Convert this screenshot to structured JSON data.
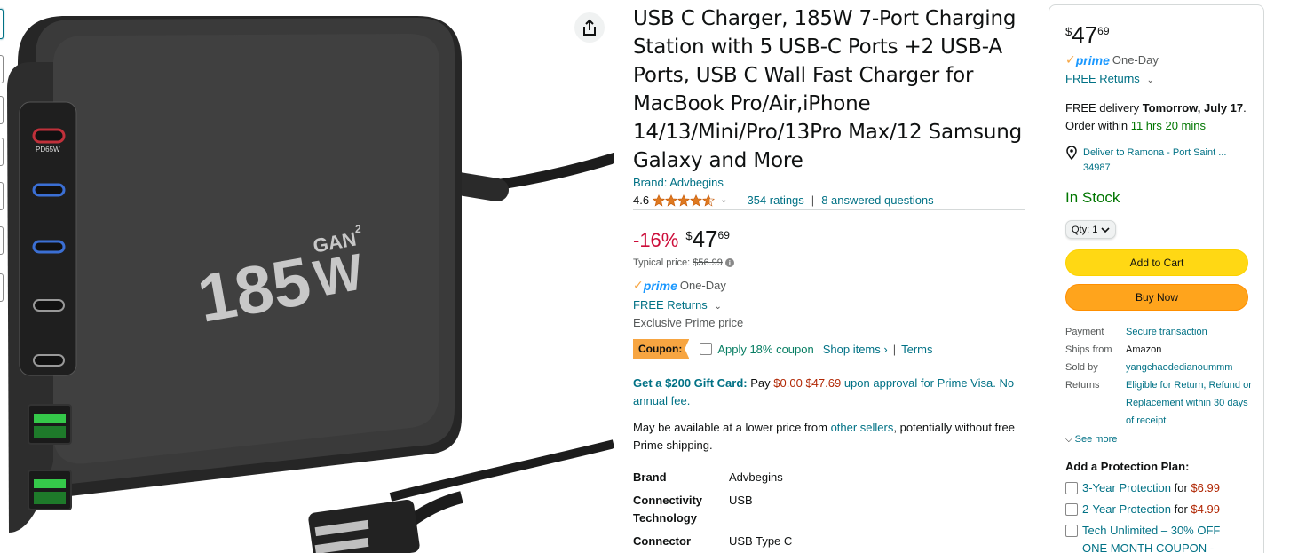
{
  "product": {
    "title": "USB C Charger, 185W 7-Port Charging Station with 5 USB-C Ports +2 USB-A Ports, USB C Wall Fast Charger for MacBook Pro/Air,iPhone 14/13/Mini/Pro/13Pro Max/12 Samsung Galaxy and More",
    "brand_link": "Brand: Advbegins",
    "rating": "4.6",
    "rating_value": 4.6,
    "ratings_count": "354 ratings",
    "answered_questions": "8 answered questions",
    "separator": "|"
  },
  "image": {
    "label_watts": "185",
    "label_w": "W",
    "label_gan": "GAN",
    "label_sup": "2",
    "port_label": "PD65W"
  },
  "pricing": {
    "discount": "-16%",
    "currency": "$",
    "price_whole": "47",
    "price_fraction": "69",
    "typical_label": "Typical price:",
    "typical_price": "$56.99",
    "info_icon": "i"
  },
  "prime": {
    "check": "✓",
    "logo": "prime",
    "speed": "One-Day",
    "free_returns": "FREE Returns",
    "exclusive": "Exclusive Prime price"
  },
  "coupon": {
    "badge": "Coupon:",
    "apply": "Apply 18% coupon",
    "shop_items": "Shop items ›",
    "separator": "|",
    "terms": "Terms"
  },
  "giftcard": {
    "bold": "Get a $200 Gift Card:",
    "pay": "Pay",
    "pay_amount": "$0.00",
    "old_amount": "$47.69",
    "rest": "upon approval for Prime Visa. No annual fee."
  },
  "lower_price": {
    "pre": "May be available at a lower price from",
    "link": "other sellers",
    "post": ", potentially without free Prime shipping."
  },
  "specs": [
    {
      "key": "Brand",
      "value": "Advbegins"
    },
    {
      "key": "Connectivity Technology",
      "value": "USB"
    },
    {
      "key": "Connector",
      "value": "USB Type C"
    }
  ],
  "buybox": {
    "currency": "$",
    "price_whole": "47",
    "price_fraction": "69",
    "check": "✓",
    "prime_logo": "prime",
    "prime_speed": "One-Day",
    "free_returns": "FREE Returns",
    "delivery_pre": "FREE delivery",
    "delivery_bold": "Tomorrow, July 17",
    "delivery_mid": ". Order within",
    "delivery_time": "11 hrs 20 mins",
    "deliver_to_line1": "Deliver to Ramona - Port Saint ...",
    "deliver_to_line2": "34987",
    "in_stock": "In Stock",
    "qty_label": "Qty: 1",
    "add_to_cart": "Add to Cart",
    "buy_now": "Buy Now",
    "details": [
      {
        "key": "Payment",
        "value": "Secure transaction",
        "link": true
      },
      {
        "key": "Ships from",
        "value": "Amazon",
        "link": false
      },
      {
        "key": "Sold by",
        "value": "yangchaodedianoummm",
        "link": true
      },
      {
        "key": "Returns",
        "value": "Eligible for Return, Refund or Replacement within 30 days of receipt",
        "link": true
      }
    ],
    "see_more": "See more",
    "protection_title": "Add a Protection Plan:",
    "protection": [
      {
        "label": "3-Year Protection",
        "for": "for",
        "amount": "$6.99"
      },
      {
        "label": "2-Year Protection",
        "for": "for",
        "amount": "$4.99"
      },
      {
        "label": "Tech Unlimited – 30% OFF ONE MONTH COUPON -",
        "for": "",
        "amount": ""
      }
    ]
  },
  "colors": {
    "link": "#007185",
    "discount_red": "#cc0c39",
    "price_red": "#b12704",
    "prime_blue": "#1a98ff",
    "coupon_orange": "#f7a541",
    "stock_green": "#007600",
    "cart_yellow": "#ffd814",
    "buy_orange": "#ffa41c"
  }
}
